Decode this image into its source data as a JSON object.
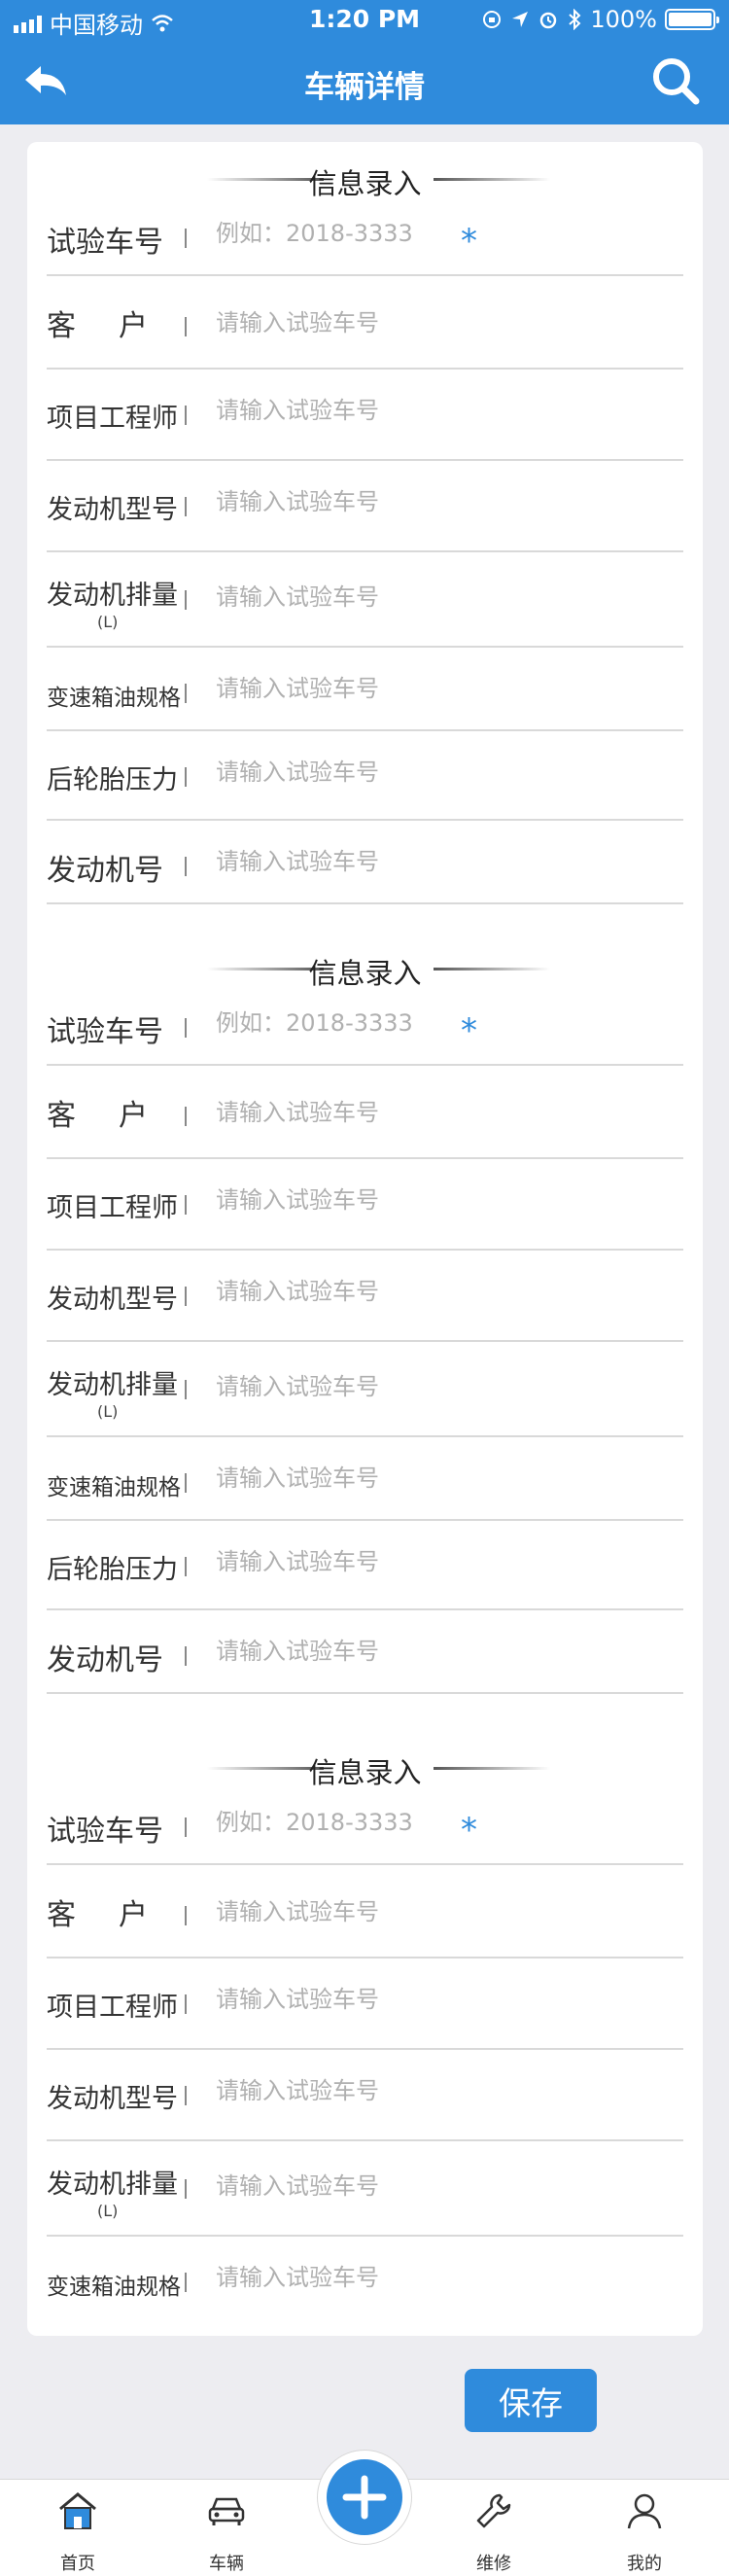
{
  "status_bar": {
    "carrier": "中国移动",
    "time": "1:20 PM",
    "battery": "100%"
  },
  "nav": {
    "title": "车辆详情",
    "back_icon": "back-arrow-icon",
    "search_icon": "search-icon"
  },
  "section_title": "信息录入",
  "sections": [
    {
      "fields": [
        {
          "label": "试验车号",
          "placeholder": "例如：2018-3333",
          "required": "*"
        },
        {
          "label": "客户",
          "placeholder": "请输入试验车号"
        },
        {
          "label": "项目工程师",
          "placeholder": "请输入试验车号"
        },
        {
          "label": "发动机型号",
          "placeholder": "请输入试验车号"
        },
        {
          "label": "发动机排量",
          "sub": "(L)",
          "placeholder": "请输入试验车号"
        },
        {
          "label": "变速箱油规格",
          "placeholder": "请输入试验车号"
        },
        {
          "label": "后轮胎压力",
          "placeholder": "请输入试验车号"
        },
        {
          "label": "发动机号",
          "placeholder": "请输入试验车号"
        }
      ]
    },
    {
      "fields": [
        {
          "label": "试验车号",
          "placeholder": "例如：2018-3333",
          "required": "*"
        },
        {
          "label": "客户",
          "placeholder": "请输入试验车号"
        },
        {
          "label": "项目工程师",
          "placeholder": "请输入试验车号"
        },
        {
          "label": "发动机型号",
          "placeholder": "请输入试验车号"
        },
        {
          "label": "发动机排量",
          "sub": "(L)",
          "placeholder": "请输入试验车号"
        },
        {
          "label": "变速箱油规格",
          "placeholder": "请输入试验车号"
        },
        {
          "label": "后轮胎压力",
          "placeholder": "请输入试验车号"
        },
        {
          "label": "发动机号",
          "placeholder": "请输入试验车号"
        }
      ]
    },
    {
      "fields": [
        {
          "label": "试验车号",
          "placeholder": "例如：2018-3333",
          "required": "*"
        },
        {
          "label": "客户",
          "placeholder": "请输入试验车号"
        },
        {
          "label": "项目工程师",
          "placeholder": "请输入试验车号"
        },
        {
          "label": "发动机型号",
          "placeholder": "请输入试验车号"
        },
        {
          "label": "发动机排量",
          "sub": "(L)",
          "placeholder": "请输入试验车号"
        },
        {
          "label": "变速箱油规格",
          "placeholder": "请输入试验车号"
        }
      ]
    }
  ],
  "save_label": "保存",
  "tabbar": {
    "items": [
      {
        "label": "首页",
        "icon": "home-icon"
      },
      {
        "label": "车辆",
        "icon": "car-icon"
      },
      {
        "label": "维修",
        "icon": "wrench-icon"
      },
      {
        "label": "我的",
        "icon": "user-icon"
      }
    ],
    "fab_icon": "plus-icon"
  },
  "colors": {
    "primary": "#2f8bdc",
    "background": "#ededf1"
  }
}
